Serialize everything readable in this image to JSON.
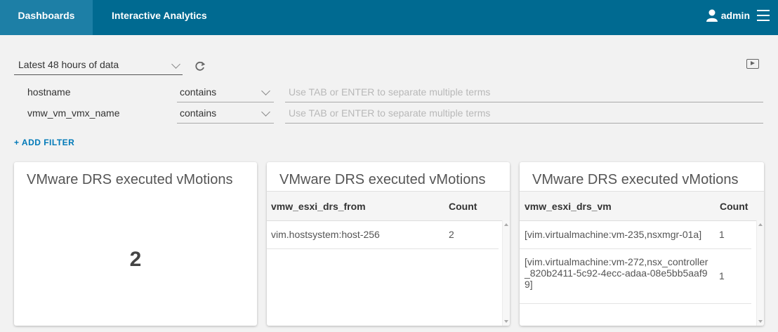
{
  "header": {
    "tabs": [
      {
        "label": "Dashboards",
        "active": true
      },
      {
        "label": "Interactive Analytics",
        "active": false
      }
    ],
    "user": "admin",
    "bg_color": "#006a91",
    "active_tab_color": "#1d7fa6"
  },
  "time_range": {
    "value": "Latest 48 hours of data"
  },
  "filters": [
    {
      "field": "hostname",
      "operator": "contains",
      "placeholder": "Use TAB or ENTER to separate multiple terms"
    },
    {
      "field": "vmw_vm_vmx_name",
      "operator": "contains",
      "placeholder": "Use TAB or ENTER to separate multiple terms"
    }
  ],
  "add_filter_label": "+ ADD FILTER",
  "widgets": [
    {
      "title": "VMware DRS executed vMotions",
      "value": "2"
    },
    {
      "title": "VMware DRS executed vMotions",
      "columns": [
        "vmw_esxi_drs_from",
        "Count"
      ],
      "rows": [
        [
          "vim.hostsystem:host-256",
          "2"
        ]
      ]
    },
    {
      "title": "VMware DRS executed vMotions",
      "columns": [
        "vmw_esxi_drs_vm",
        "Count"
      ],
      "rows": [
        [
          "[vim.virtualmachine:vm-235,nsxmgr-01a]",
          "1"
        ],
        [
          "[vim.virtualmachine:vm-272,nsx_controller_820b2411-5c92-4ecc-adaa-08e5bb5aaf99]",
          "1"
        ]
      ]
    }
  ]
}
